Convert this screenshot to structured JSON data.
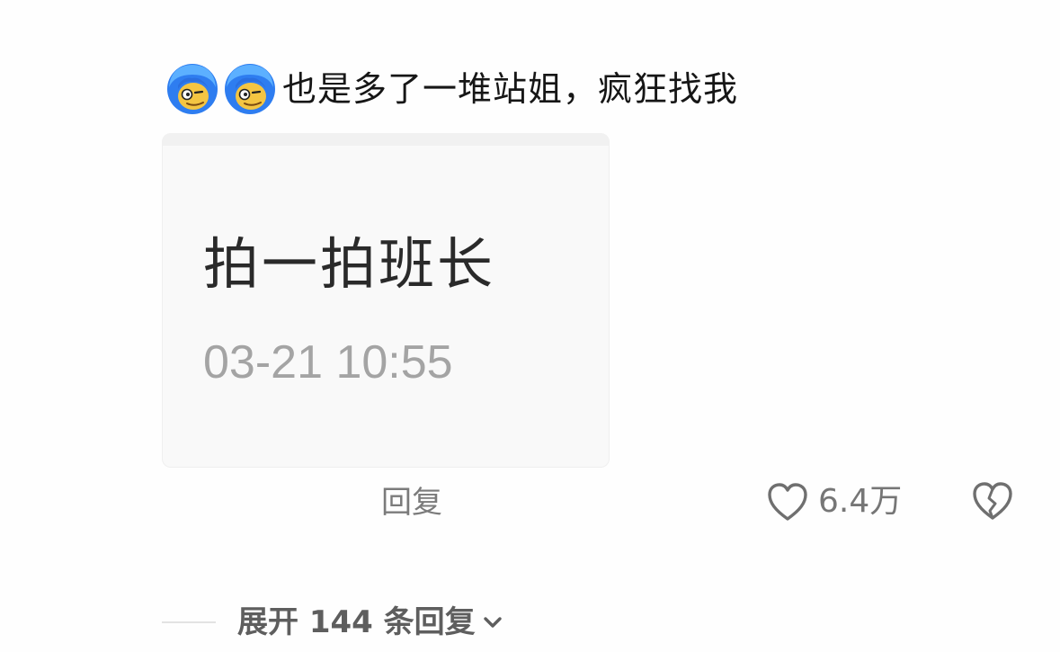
{
  "comment": {
    "emojis": [
      "blue-hair-emoji-icon",
      "blue-hair-emoji-icon"
    ],
    "text": "也是多了一堆站姐，疯狂找我"
  },
  "image_card": {
    "title": "拍一拍班长",
    "time": "03-21 10:55"
  },
  "actions": {
    "reply_label": "回复",
    "like_count": "6.4万",
    "like_icon": "heart-outline-icon",
    "dislike_icon": "broken-heart-icon"
  },
  "expand": {
    "label": "展开 144 条回复",
    "icon": "chevron-down-icon"
  },
  "colors": {
    "text_primary": "#161616",
    "text_secondary": "#7b7b7b",
    "card_background": "#f9f9f9",
    "emoji_hair": "#2e7df0",
    "emoji_face": "#f4c542"
  }
}
